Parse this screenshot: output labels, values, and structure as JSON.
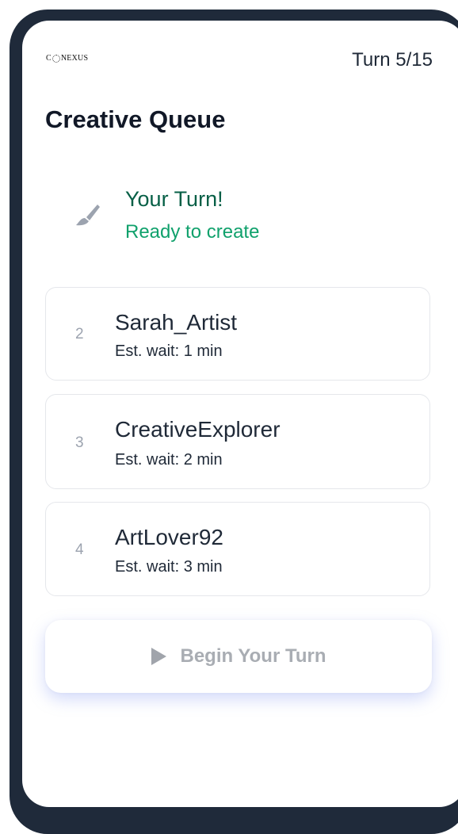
{
  "header": {
    "logo_text_pre": "C",
    "logo_text_post": "NEXUS",
    "turn_counter": "Turn 5/15"
  },
  "page": {
    "title": "Creative Queue"
  },
  "current_turn": {
    "icon": "paintbrush-icon",
    "title": "Your Turn!",
    "subtitle": "Ready to create"
  },
  "queue": [
    {
      "position": "2",
      "name": "Sarah_Artist",
      "wait": "Est. wait: 1 min"
    },
    {
      "position": "3",
      "name": "CreativeExplorer",
      "wait": "Est. wait: 2 min"
    },
    {
      "position": "4",
      "name": "ArtLover92",
      "wait": "Est. wait: 3 min"
    }
  ],
  "action": {
    "icon": "play-icon",
    "label": "Begin Your Turn"
  },
  "colors": {
    "frame": "#1f2a3a",
    "accent_dark_green": "#065f46",
    "accent_green": "#10a16c",
    "muted_text": "#9ca3af"
  }
}
